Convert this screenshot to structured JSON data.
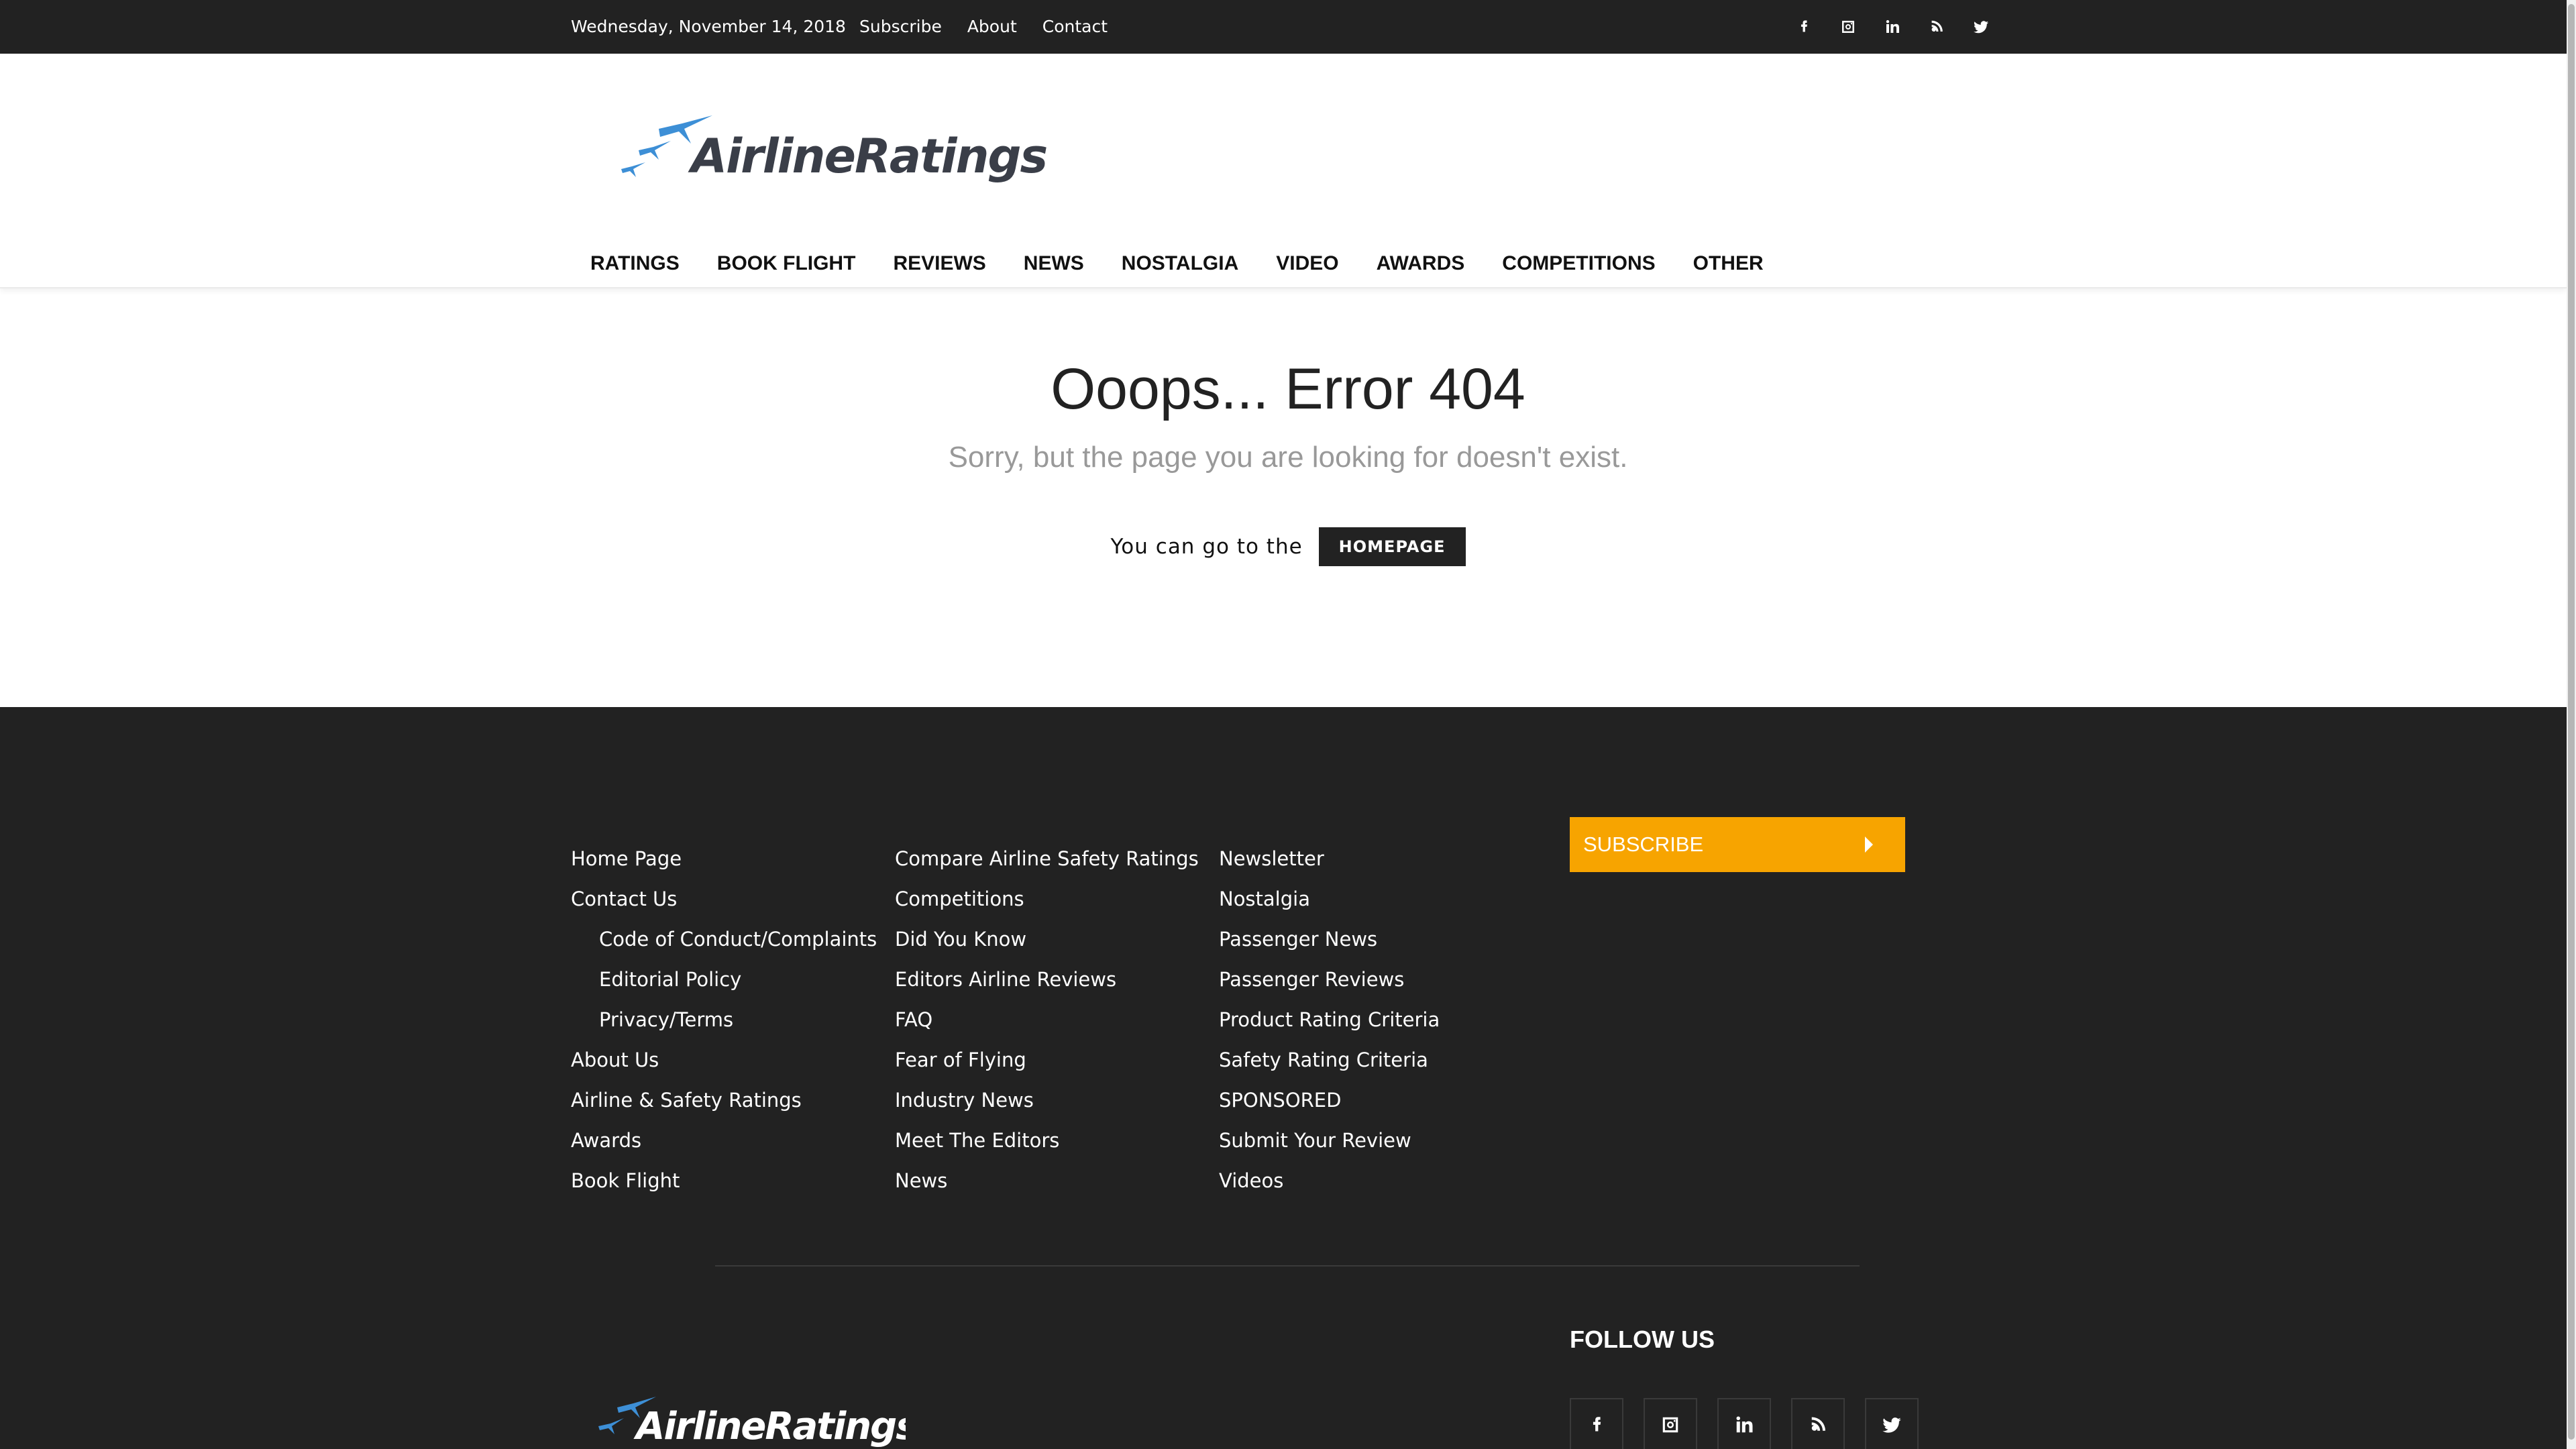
{
  "topbar": {
    "date": "Wednesday, November 14, 2018",
    "links": [
      "Subscribe",
      "About",
      "Contact"
    ],
    "social_icons": [
      "facebook-icon",
      "instagram-icon",
      "linkedin-icon",
      "rss-icon",
      "twitter-icon"
    ]
  },
  "header": {
    "logo_text": "AirlineRatings",
    "nav": [
      "RATINGS",
      "BOOK FLIGHT",
      "REVIEWS",
      "NEWS",
      "NOSTALGIA",
      "VIDEO",
      "AWARDS",
      "COMPETITIONS",
      "OTHER"
    ]
  },
  "error": {
    "title": "Ooops... Error 404",
    "subtitle": "Sorry, but the page you are looking for doesn't exist.",
    "go_text": "You can go to the",
    "homepage_button": "HOMEPAGE"
  },
  "footer": {
    "col1": [
      "Home Page",
      "Contact Us",
      "Code of Conduct/Complaints",
      "Editorial Policy",
      "Privacy/Terms",
      "About Us",
      "Airline & Safety Ratings",
      "Awards",
      "Book Flight"
    ],
    "col2": [
      "Compare Airline Safety Ratings",
      "Competitions",
      "Did You Know",
      "Editors Airline Reviews",
      "FAQ",
      "Fear of Flying",
      "Industry News",
      "Meet The Editors",
      "News"
    ],
    "col3": [
      "Newsletter",
      "Nostalgia",
      "Passenger News",
      "Passenger Reviews",
      "Product Rating Criteria",
      "Safety Rating Criteria",
      "SPONSORED",
      "Submit Your Review",
      "Videos"
    ],
    "subscribe_label": "SUBSCRIBE",
    "follow_us": "FOLLOW US",
    "logo_text": "AirlineRatings"
  },
  "colors": {
    "dark": "#222222",
    "accent": "#f7a400",
    "logo_blue": "#3d8fd6",
    "logo_text": "#3a3e48"
  }
}
